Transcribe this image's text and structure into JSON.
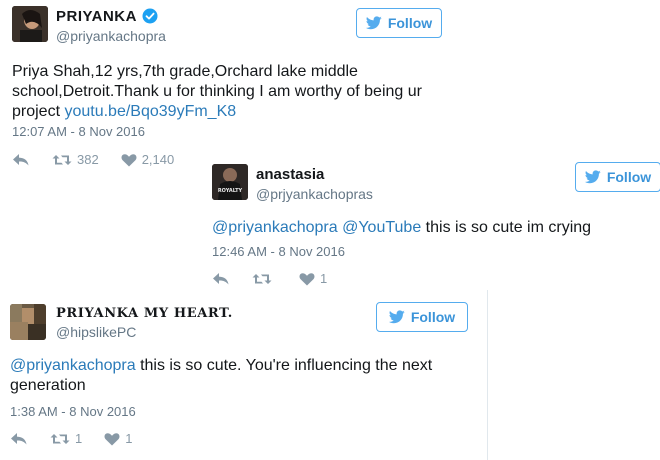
{
  "tweets": [
    {
      "name": "PRIYANKA",
      "handle": "@priyankachopra",
      "verified": true,
      "follow_label": "Follow",
      "text_lines": [
        "Priya Shah,12 yrs,7th grade,Orchard lake middle",
        "school,Detroit.Thank u for thinking I am worthy of being ur",
        "project "
      ],
      "link": "youtu.be/Bqo39yFm_K8",
      "timestamp": "12:07 AM - 8 Nov 2016",
      "retweets": "382",
      "likes": "2,140",
      "avatar_color": "#2a2622"
    },
    {
      "name": "anastasia",
      "handle": "@prjyankachopras",
      "follow_label": "Follow",
      "mention1": "@priyankachopra",
      "mention2": "@YouTube",
      "text_rest": " this is so cute im crying",
      "timestamp": "12:46 AM - 8 Nov 2016",
      "retweets": "",
      "likes": "1",
      "avatar_color": "#3a3230",
      "avatar_text": "ROYALTY"
    },
    {
      "name": "PRIYANKA MY HEART.",
      "handle": "@hipslikePC",
      "follow_label": "Follow",
      "mention": "@priyankachopra",
      "text_rest": " this is so cute. You're influencing the next",
      "text_line2": "generation",
      "timestamp": "1:38 AM - 8 Nov 2016",
      "retweets": "1",
      "likes": "1",
      "avatar_color": "#5a4a38"
    }
  ],
  "colors": {
    "accent": "#55acee",
    "link": "#2b7bb9",
    "muted": "#657786",
    "verified": "#1da1f2"
  }
}
